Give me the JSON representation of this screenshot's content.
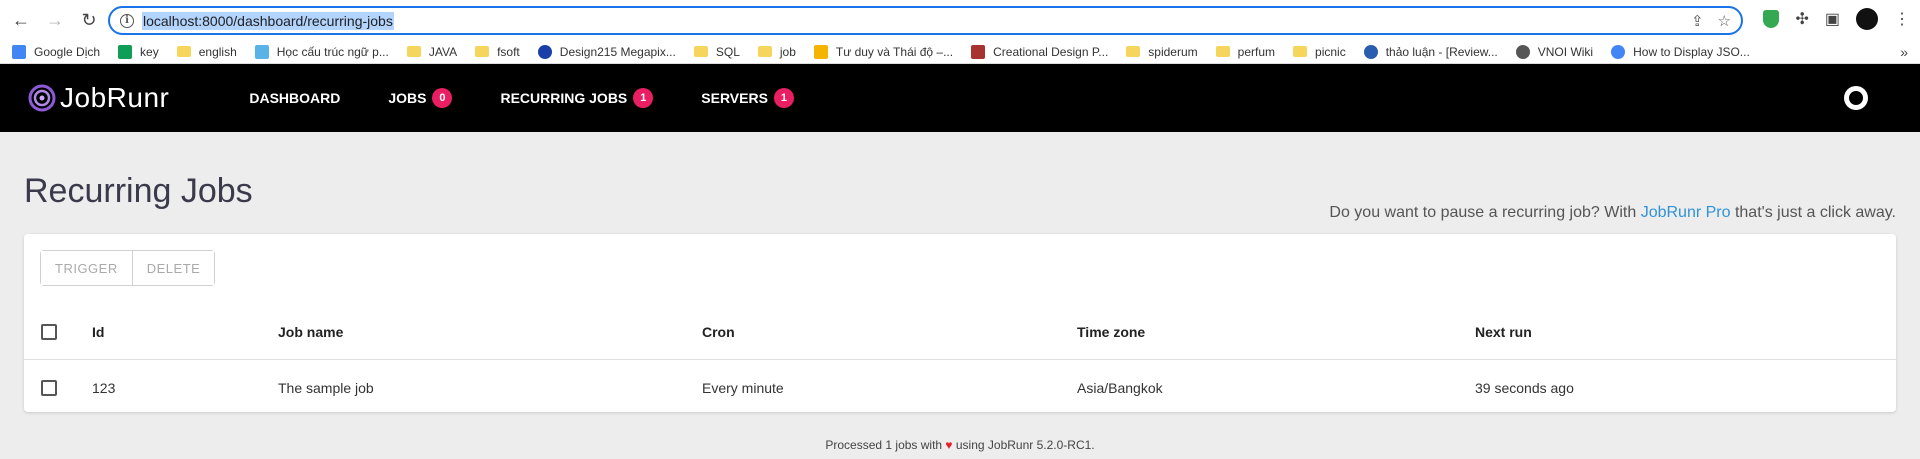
{
  "browser": {
    "url": "localhost:8000/dashboard/recurring-jobs",
    "bookmarks": [
      {
        "label": "Google Dịch",
        "icon": "translate-icon"
      },
      {
        "label": "key",
        "icon": "sheets-icon"
      },
      {
        "label": "english",
        "icon": "folder-icon"
      },
      {
        "label": "Học cấu trúc ngữ p...",
        "icon": "site-icon"
      },
      {
        "label": "JAVA",
        "icon": "folder-icon"
      },
      {
        "label": "fsoft",
        "icon": "folder-icon"
      },
      {
        "label": "Design215 Megapix...",
        "icon": "site-icon"
      },
      {
        "label": "SQL",
        "icon": "folder-icon"
      },
      {
        "label": "job",
        "icon": "folder-icon"
      },
      {
        "label": "Tư duy và Thái độ –...",
        "icon": "site-icon"
      },
      {
        "label": "Creational Design P...",
        "icon": "site-icon"
      },
      {
        "label": "spiderum",
        "icon": "folder-icon"
      },
      {
        "label": "perfum",
        "icon": "folder-icon"
      },
      {
        "label": "picnic",
        "icon": "folder-icon"
      },
      {
        "label": "thảo luận - [Review...",
        "icon": "site-icon"
      },
      {
        "label": "VNOI Wiki",
        "icon": "site-icon"
      },
      {
        "label": "How to Display JSO...",
        "icon": "google-icon"
      }
    ]
  },
  "app": {
    "logo_text": "JobRunr",
    "nav": [
      {
        "label": "Dashboard",
        "badge": null
      },
      {
        "label": "Jobs",
        "badge": "0"
      },
      {
        "label": "Recurring Jobs",
        "badge": "1"
      },
      {
        "label": "Servers",
        "badge": "1"
      }
    ]
  },
  "page": {
    "title": "Recurring Jobs",
    "pro_note_prefix": "Do you want to pause a recurring job? With ",
    "pro_note_link": "JobRunr Pro",
    "pro_note_suffix": " that's just a click away."
  },
  "toolbar": {
    "trigger_label": "Trigger",
    "delete_label": "Delete"
  },
  "table": {
    "headers": {
      "id": "Id",
      "name": "Job name",
      "cron": "Cron",
      "tz": "Time zone",
      "next": "Next run"
    },
    "rows": [
      {
        "id": "123",
        "name": "The sample job",
        "cron": "Every minute",
        "tz": "Asia/Bangkok",
        "next": "39 seconds ago"
      }
    ]
  },
  "footer": {
    "prefix": "Processed 1 jobs with ",
    "heart": "♥",
    "suffix": " using JobRunr 5.2.0-RC1."
  },
  "colors": {
    "accent_badge": "#e91e63",
    "link": "#2f93d9",
    "navbar": "#000000"
  }
}
